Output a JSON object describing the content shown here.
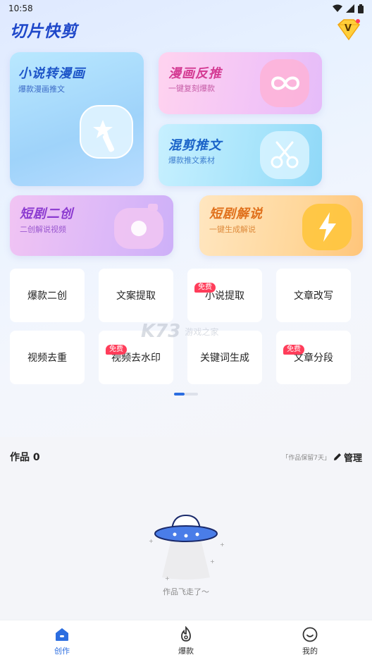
{
  "status_bar": {
    "time": "10:58"
  },
  "header": {
    "title": "切片快剪",
    "vip_letter": "V"
  },
  "cards": {
    "novel_to_comic": {
      "title": "小说转漫画",
      "subtitle": "爆款漫画推文"
    },
    "comic_reverse": {
      "title": "漫画反推",
      "subtitle": "一键复刻爆款"
    },
    "mix_cut": {
      "title": "混剪推文",
      "subtitle": "爆款推文素材"
    },
    "short_drama_remix": {
      "title": "短剧二创",
      "subtitle": "二创解说视频"
    },
    "short_drama_explain": {
      "title": "短剧解说",
      "subtitle": "一键生成解说"
    }
  },
  "tools": [
    {
      "label": "爆款二创",
      "badge": ""
    },
    {
      "label": "文案提取",
      "badge": ""
    },
    {
      "label": "小说提取",
      "badge": "免费"
    },
    {
      "label": "文章改写",
      "badge": ""
    },
    {
      "label": "视频去重",
      "badge": ""
    },
    {
      "label": "视频去水印",
      "badge": "免费"
    },
    {
      "label": "关键词生成",
      "badge": ""
    },
    {
      "label": "文章分段",
      "badge": "免费"
    }
  ],
  "pager": {
    "current_page": 1,
    "total_pages": 2
  },
  "watermark": {
    "logo": "K73",
    "text": "游戏之家"
  },
  "works": {
    "title": "作品",
    "count": "0",
    "keep_note": "「作品保留7天」",
    "manage_label": "管理",
    "empty_text": "作品飞走了～"
  },
  "tabbar": {
    "items": [
      {
        "label": "创作",
        "icon": "home-icon",
        "active": true
      },
      {
        "label": "爆款",
        "icon": "flame-icon",
        "active": false
      },
      {
        "label": "我的",
        "icon": "smile-face-icon",
        "active": false
      }
    ]
  },
  "colors": {
    "accent": "#2b6de0",
    "free_badge": "#ff3d5a",
    "title_blue": "#1e47c9"
  }
}
